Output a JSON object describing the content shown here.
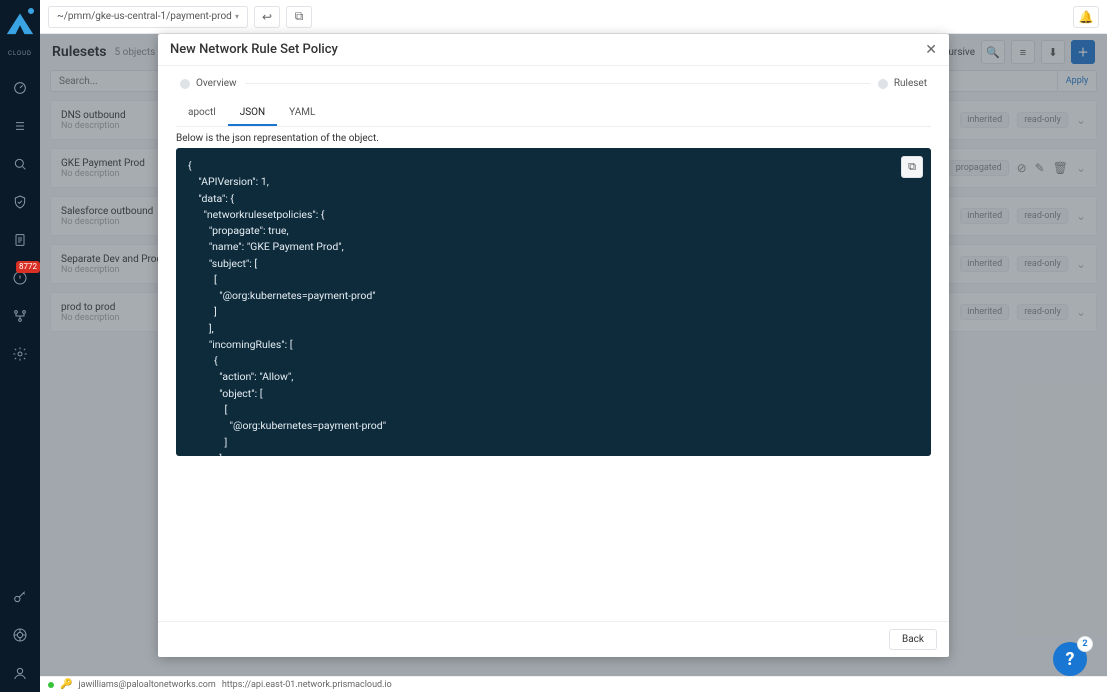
{
  "brand": "CLOUD",
  "leftbar": {
    "badge": "8772"
  },
  "topbar": {
    "breadcrumb": "~/pmm/gke-us-central-1/payment-prod"
  },
  "header": {
    "title": "Rulesets",
    "count": "5 objects",
    "recursive": "Recursive"
  },
  "search": {
    "placeholder": "Search...",
    "apply": "Apply"
  },
  "rows": [
    {
      "name": "DNS outbound",
      "desc": "No description",
      "tags": [
        "inherited",
        "read-only"
      ],
      "actions": false
    },
    {
      "name": "GKE Payment Prod",
      "desc": "No description",
      "tags": [
        "propagated"
      ],
      "actions": true
    },
    {
      "name": "Salesforce outbound",
      "desc": "No description",
      "tags": [
        "inherited",
        "read-only"
      ],
      "actions": false
    },
    {
      "name": "Separate Dev and Prod",
      "desc": "No description",
      "tags": [
        "inherited",
        "read-only"
      ],
      "actions": false
    },
    {
      "name": "prod to prod",
      "desc": "No description",
      "tags": [
        "inherited",
        "read-only"
      ],
      "actions": false
    }
  ],
  "statusbar": {
    "user": "jawilliams@paloaltonetworks.com",
    "url": "https://api.east-01.network.prismacloud.io"
  },
  "modal": {
    "title": "New Network Rule Set Policy",
    "step1": "Overview",
    "step2": "Ruleset",
    "tabs": {
      "apoctl": "apoctl",
      "json": "JSON",
      "yaml": "YAML"
    },
    "jsonlabel": "Below is the json representation of the object.",
    "back": "Back",
    "code": "{\n    \"APIVersion\": 1,\n    \"data\": {\n      \"networkrulesetpolicies\": {\n        \"propagate\": true,\n        \"name\": \"GKE Payment Prod\",\n        \"subject\": [\n          [\n            \"@org:kubernetes=payment-prod\"\n          ]\n        ],\n        \"incomingRules\": [\n          {\n            \"action\": \"Allow\",\n            \"object\": [\n              [\n                \"@org:kubernetes=payment-prod\"\n              ]\n            ],\n            \"protocolPorts\": [\n              \"any\"\n            ]\n          }\n"
  },
  "help": {
    "count": "2"
  }
}
